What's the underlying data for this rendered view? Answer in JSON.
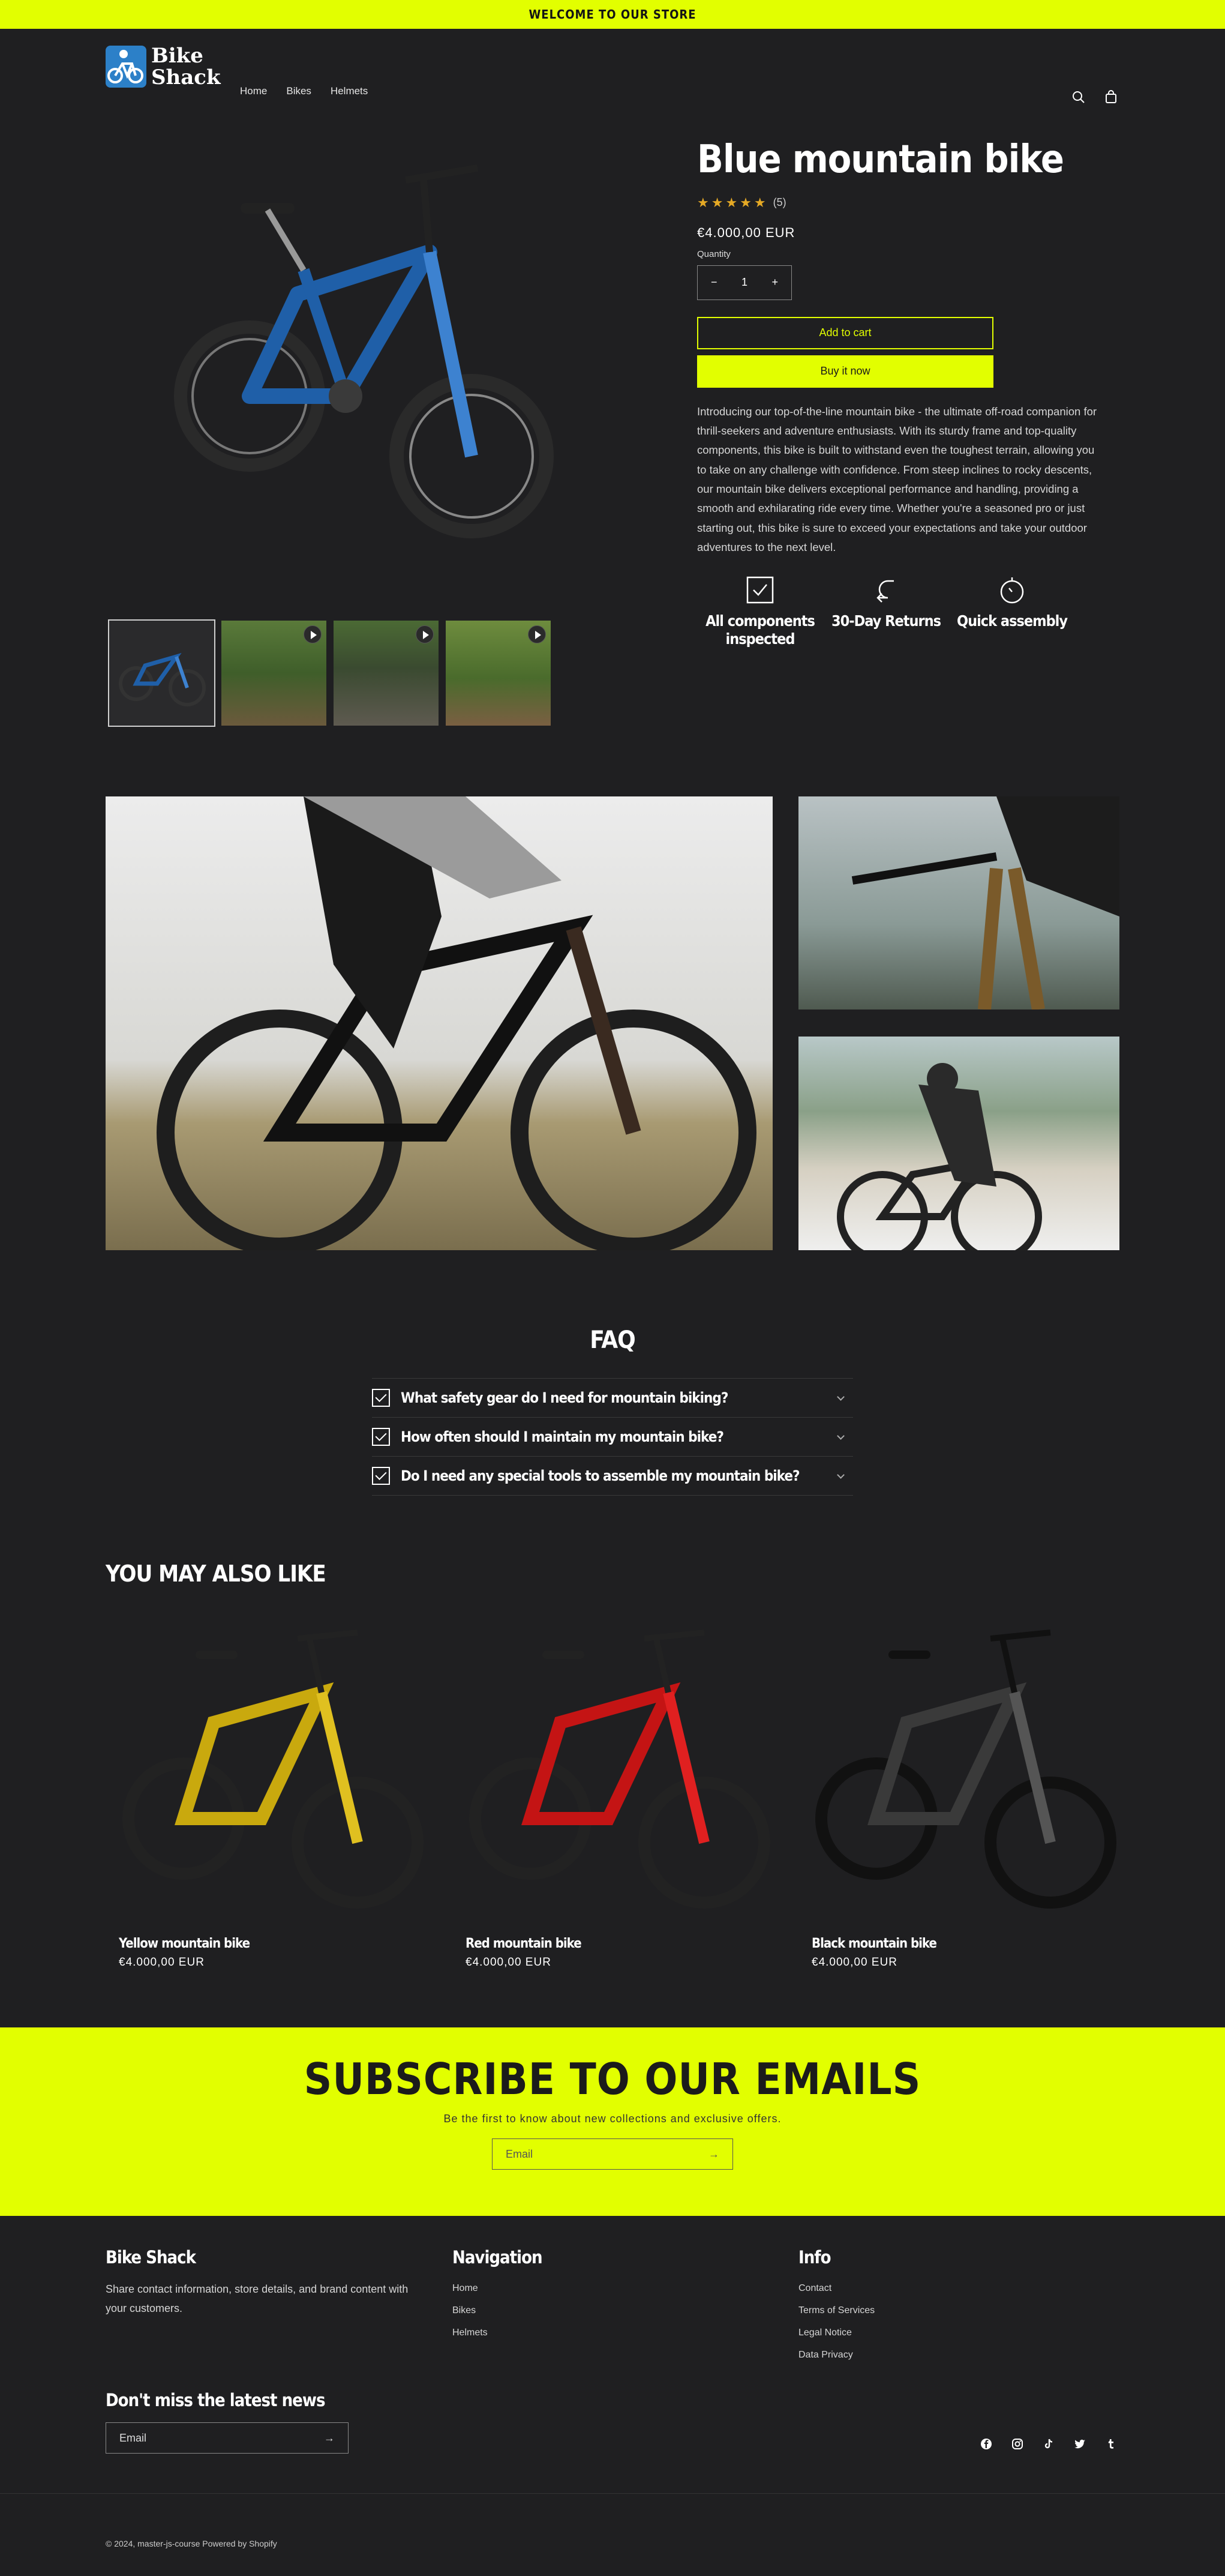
{
  "announcement": "WELCOME TO OUR STORE",
  "brand": {
    "line1": "Bike",
    "line2": "Shack"
  },
  "nav": [
    "Home",
    "Bikes",
    "Helmets"
  ],
  "icons": {
    "search": "search-icon",
    "cart": "cart-icon"
  },
  "colors": {
    "accent": "#e2ff00",
    "background": "#1f1f21",
    "star": "#e5a925",
    "bike_main": "#1f5fa8"
  },
  "product": {
    "title": "Blue mountain bike",
    "stars": "★★★★★",
    "rating_count": "(5)",
    "rating_value": 5,
    "price": "€4.000,00 EUR",
    "quantity_label": "Quantity",
    "quantity": "1",
    "minus": "−",
    "plus": "+",
    "add_to_cart": "Add to cart",
    "buy_now": "Buy it now",
    "description": "Introducing our top-of-the-line mountain bike - the ultimate off-road companion for thrill-seekers and adventure enthusiasts. With its sturdy frame and top-quality components, this bike is built to withstand even the toughest terrain, allowing you to take on any challenge with confidence. From steep inclines to rocky descents, our mountain bike delivers exceptional performance and handling, providing a smooth and exhilarating ride every time. Whether you're a seasoned pro or just starting out, this bike is sure to exceed your expectations and take your outdoor adventures to the next level.",
    "features": [
      {
        "icon": "checkbox-icon",
        "label": "All components inspected"
      },
      {
        "icon": "return-arrow-icon",
        "label": "30-Day Returns"
      },
      {
        "icon": "stopwatch-icon",
        "label": "Quick assembly"
      }
    ]
  },
  "faq": {
    "title": "FAQ",
    "items": [
      "What safety gear do I need for mountain biking?",
      "How often should I maintain my mountain bike?",
      "Do I need any special tools to assemble my mountain bike?"
    ]
  },
  "related": {
    "title": "YOU MAY ALSO LIKE",
    "items": [
      {
        "name": "Yellow mountain bike",
        "price": "€4.000,00 EUR",
        "color": "#c9a90e"
      },
      {
        "name": "Red mountain bike",
        "price": "€4.000,00 EUR",
        "color": "#c41414"
      },
      {
        "name": "Black mountain bike",
        "price": "€4.000,00 EUR",
        "color": "#2a2a2a"
      }
    ]
  },
  "subscribe": {
    "title": "SUBSCRIBE TO OUR EMAILS",
    "text": "Be the first to know about new collections and exclusive offers.",
    "placeholder": "Email",
    "arrow": "→"
  },
  "footer": {
    "brand_title": "Bike Shack",
    "brand_text": "Share contact information, store details, and brand content with your customers.",
    "nav_title": "Navigation",
    "nav_links": [
      "Home",
      "Bikes",
      "Helmets"
    ],
    "info_title": "Info",
    "info_links": [
      "Contact",
      "Terms of Services",
      "Legal Notice",
      "Data Privacy"
    ],
    "news_title": "Don't miss the latest news",
    "news_placeholder": "Email",
    "news_arrow": "→",
    "social": [
      "facebook-icon",
      "instagram-icon",
      "tiktok-icon",
      "twitter-icon",
      "tumblr-icon"
    ],
    "copyright": "© 2024, master-js-course Powered by Shopify"
  }
}
